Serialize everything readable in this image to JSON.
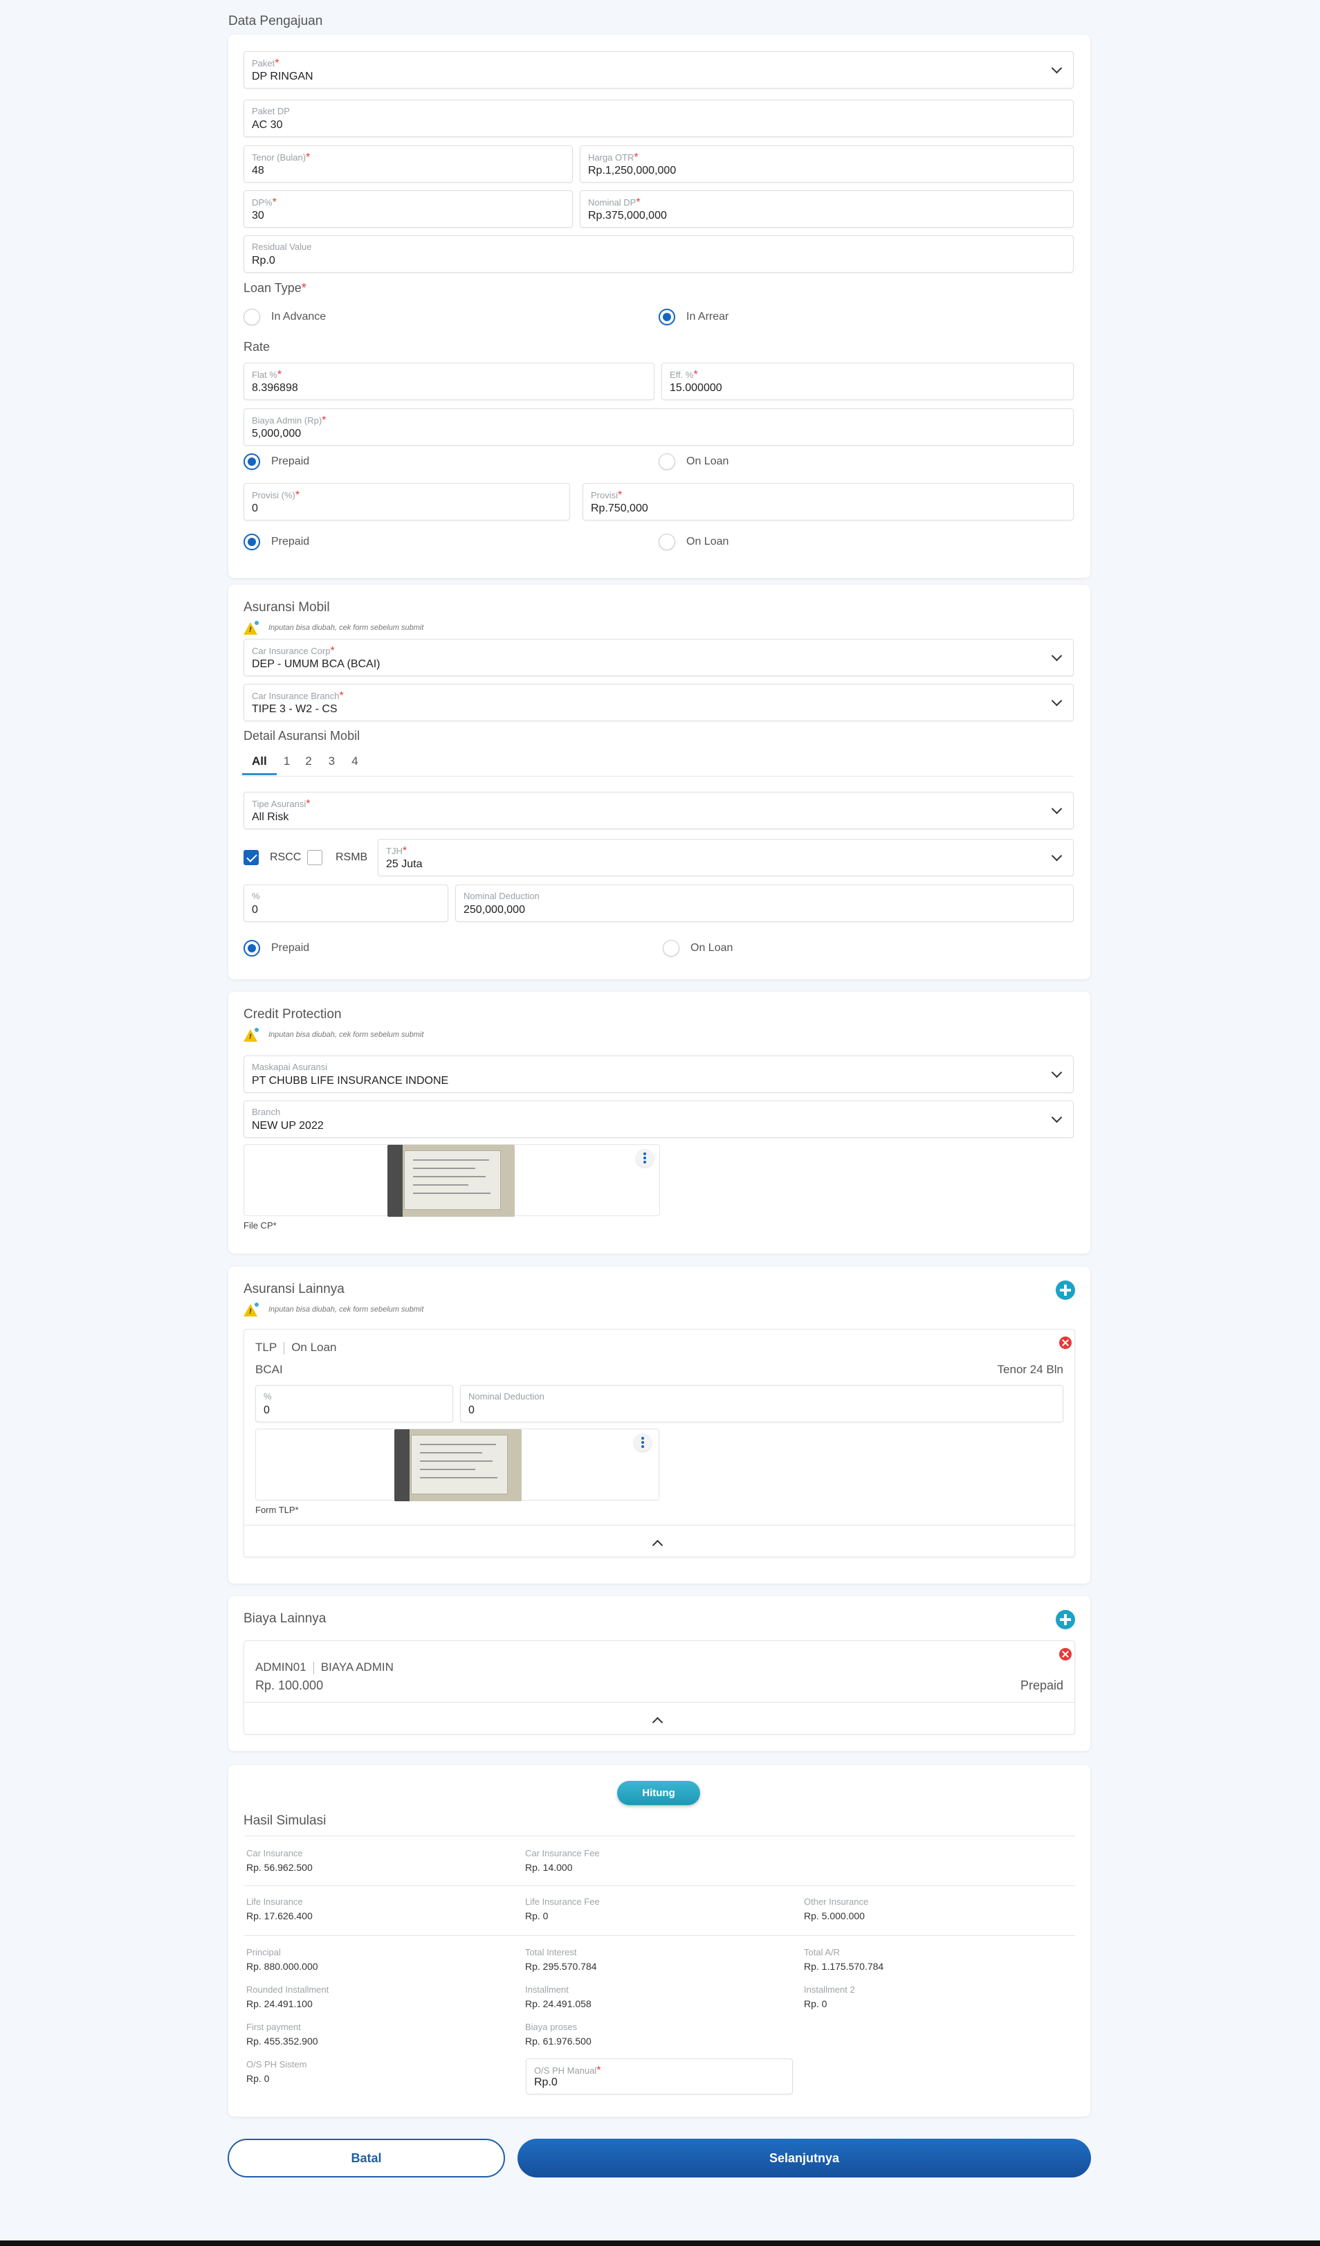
{
  "data_pengajuan": {
    "title": "Data Pengajuan",
    "paket": {
      "label": "Paket",
      "value": "DP RINGAN"
    },
    "paket_dp": {
      "label": "Paket DP",
      "value": "AC 30"
    },
    "tenor": {
      "label": "Tenor (Bulan)",
      "value": "48"
    },
    "harga_otr": {
      "label": "Harga OTR",
      "value": "Rp.1,250,000,000"
    },
    "dp_percent": {
      "label": "DP%",
      "value": "30"
    },
    "nominal_dp": {
      "label": "Nominal DP",
      "value": "Rp.375,000,000"
    },
    "residual": {
      "label": "Residual Value",
      "value": "Rp.0"
    },
    "loan_type": {
      "label": "Loan Type",
      "options": [
        "In Advance",
        "In Arrear"
      ],
      "selected": "In Arrear"
    },
    "rate_title": "Rate",
    "flat": {
      "label": "Flat %",
      "value": "8.396898"
    },
    "eff": {
      "label": "Eff. %",
      "value": "15.000000"
    },
    "biaya_admin": {
      "label": "Biaya Admin (Rp)",
      "value": "5,000,000"
    },
    "admin_payment": {
      "options": [
        "Prepaid",
        "On Loan"
      ],
      "selected": "Prepaid"
    },
    "provisi_pct": {
      "label": "Provisi (%)",
      "value": "0"
    },
    "provisi": {
      "label": "Provisi",
      "value": "Rp.750,000"
    },
    "provisi_payment": {
      "options": [
        "Prepaid",
        "On Loan"
      ],
      "selected": "Prepaid"
    }
  },
  "note_text": "Inputan bisa diubah, cek form sebelum submit",
  "asuransi_mobil": {
    "title": "Asuransi Mobil",
    "corp": {
      "label": "Car Insurance Corp",
      "value": "DEP - UMUM BCA (BCAI)"
    },
    "branch": {
      "label": "Car Insurance Branch",
      "value": "TIPE 3 - W2 - CS"
    },
    "detail_title": "Detail Asuransi Mobil",
    "tabs": [
      "All",
      "1",
      "2",
      "3",
      "4"
    ],
    "active_tab": "All",
    "tipe": {
      "label": "Tipe Asuransi",
      "value": "All Risk"
    },
    "rscc": {
      "label": "RSCC",
      "checked": true
    },
    "rsmb": {
      "label": "RSMB",
      "checked": false
    },
    "tjh": {
      "label": "TJH",
      "value": "25 Juta"
    },
    "percent": {
      "label": "%",
      "value": "0"
    },
    "nominal_deduction": {
      "label": "Nominal Deduction",
      "value": "250,000,000"
    },
    "payment": {
      "options": [
        "Prepaid",
        "On Loan"
      ],
      "selected": "Prepaid"
    }
  },
  "credit_protection": {
    "title": "Credit Protection",
    "maskapai": {
      "label": "Maskapai Asuransi",
      "value": "PT CHUBB LIFE INSURANCE INDONE"
    },
    "branch": {
      "label": "Branch",
      "value": "NEW UP 2022"
    },
    "file_label": "File CP*"
  },
  "asuransi_lainnya": {
    "title": "Asuransi Lainnya",
    "item": {
      "code": "TLP",
      "payment": "On Loan",
      "company": "BCAI",
      "tenor": "Tenor 24 Bln",
      "percent": {
        "label": "%",
        "value": "0"
      },
      "nominal_deduction": {
        "label": "Nominal Deduction",
        "value": "0"
      },
      "file_label": "Form TLP*"
    }
  },
  "biaya_lainnya": {
    "title": "Biaya Lainnya",
    "item": {
      "code": "ADMIN01",
      "name": "BIAYA ADMIN",
      "amount": "Rp. 100.000",
      "payment": "Prepaid"
    }
  },
  "hasil": {
    "button": "Hitung",
    "title": "Hasil Simulasi",
    "car_insurance": {
      "label": "Car Insurance",
      "value": "Rp. 56.962.500"
    },
    "car_insurance_fee": {
      "label": "Car Insurance Fee",
      "value": "Rp. 14.000"
    },
    "life_insurance": {
      "label": "Life Insurance",
      "value": "Rp. 17.626.400"
    },
    "life_insurance_fee": {
      "label": "Life Insurance Fee",
      "value": "Rp. 0"
    },
    "other_insurance": {
      "label": "Other Insurance",
      "value": "Rp. 5.000.000"
    },
    "principal": {
      "label": "Principal",
      "value": "Rp. 880.000.000"
    },
    "total_interest": {
      "label": "Total Interest",
      "value": "Rp. 295.570.784"
    },
    "total_ar": {
      "label": "Total A/R",
      "value": "Rp. 1.175.570.784"
    },
    "rounded_installment": {
      "label": "Rounded Installment",
      "value": "Rp. 24.491.100"
    },
    "installment": {
      "label": "Installment",
      "value": "Rp. 24.491.058"
    },
    "installment2": {
      "label": "Installment 2",
      "value": "Rp. 0"
    },
    "first_payment": {
      "label": "First payment",
      "value": "Rp. 455.352.900"
    },
    "biaya_proses": {
      "label": "Biaya proses",
      "value": "Rp. 61.976.500"
    },
    "os_ph_sistem": {
      "label": "O/S PH Sistem",
      "value": "Rp. 0"
    },
    "os_ph_manual": {
      "label": "O/S PH Manual",
      "value": "Rp.0"
    }
  },
  "footer": {
    "cancel": "Batal",
    "next": "Selanjutnya"
  }
}
